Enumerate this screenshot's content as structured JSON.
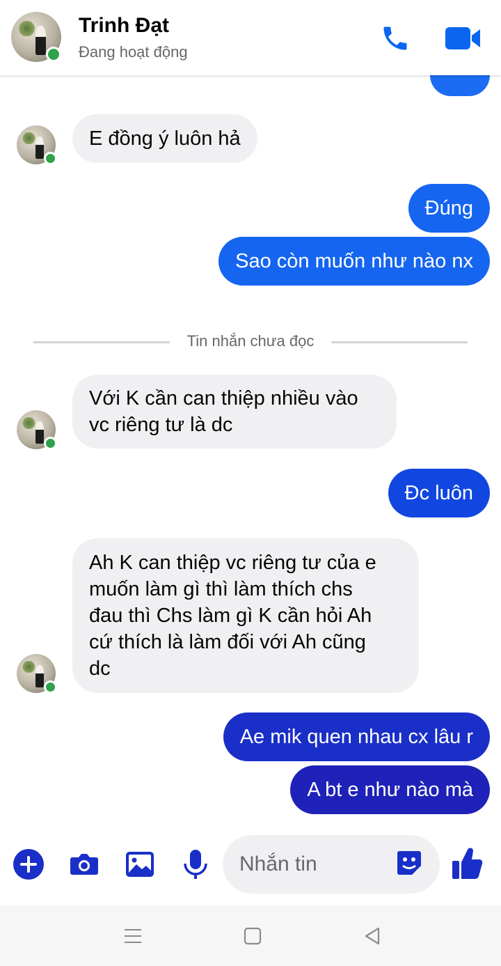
{
  "header": {
    "name": "Trinh Đạt",
    "status": "Đang hoạt động"
  },
  "messages": [
    {
      "dir": "in",
      "text": "E đồng ý luôn hả"
    },
    {
      "dir": "out",
      "text": "Đúng"
    },
    {
      "dir": "out",
      "text": "Sao còn muốn như nào nx"
    },
    {
      "dir": "in",
      "lines": [
        "Với K cần can thiệp nhiều vào",
        "vc riêng tư là dc"
      ]
    },
    {
      "dir": "out",
      "text": "Đc luôn"
    },
    {
      "dir": "in",
      "lines": [
        "Ah K can thiệp vc riêng tư của e",
        "muốn làm gì thì làm thích chs",
        "đau thì Chs làm gì K cần hỏi Ah",
        "cứ thích là làm đối với Ah cũng",
        "dc"
      ]
    },
    {
      "dir": "out",
      "text": "Ae mik quen nhau cx lâu r"
    },
    {
      "dir": "out",
      "text": "A bt e như nào mà"
    }
  ],
  "divider_label": "Tin nhắn chưa đọc",
  "composer": {
    "placeholder": "Nhắn tin"
  },
  "icons": [
    "phone-icon",
    "video-camera-icon",
    "plus-icon",
    "camera-icon",
    "gallery-icon",
    "microphone-icon",
    "sticker-icon",
    "thumbs-up-icon",
    "menu-icon",
    "home-square-icon",
    "back-triangle-icon"
  ],
  "colors": {
    "accent": "#0a66f0",
    "online": "#31a24c",
    "incoming_bg": "#f0f0f3",
    "outgoing_gradient": [
      "#1565f0",
      "#1147e0",
      "#1a2fc7",
      "#1f22b8"
    ]
  }
}
